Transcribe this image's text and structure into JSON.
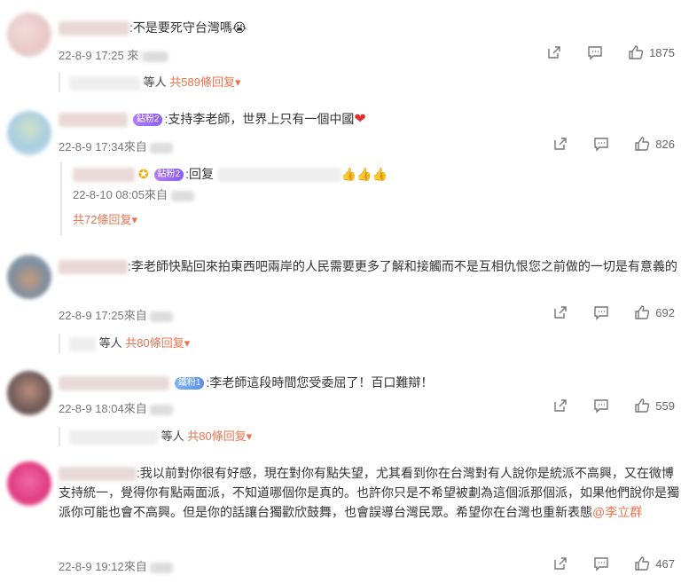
{
  "comments": [
    {
      "text": ":不是要死守台灣嗎😭",
      "time": "22-8-9 17:25",
      "source_prefix": "來",
      "likes": "1875",
      "summary_who": "等人",
      "summary_total": "共589條回复"
    },
    {
      "badge": "鉆粉2",
      "text": ":支持李老師，世界上只有一個中國",
      "time": "22-8-9 17:34",
      "source_prefix": "來自",
      "likes": "826",
      "reply": {
        "badge": "鉆粉2",
        "text": ":回复",
        "emoji": "👍👍👍",
        "time": "22-8-10 08:05",
        "source_prefix": "來自"
      },
      "summary_total": "共72條回复"
    },
    {
      "text": ":李老師快點回來拍東西吧兩岸的人民需要更多了解和接觸而不是互相仇恨您之前做的一切是有意義的",
      "time": "22-8-9 17:25",
      "source_prefix": "來自",
      "likes": "692",
      "summary_who": "等人",
      "summary_total": "共80條回复"
    },
    {
      "badge": "鐵粉1",
      "text": ":李老師這段時間您受委屈了！百口難辯！",
      "time": "22-8-9 18:04",
      "source_prefix": "來自",
      "likes": "559",
      "summary_who": "等人",
      "summary_total": "共80條回复"
    },
    {
      "text": ":我以前對你很有好感，現在對你有點失望，尤其看到你在台灣對有人說你是統派不高興，又在微博支持統一，覺得你有點兩面派，不知道哪個你是真的。也許你只是不希望被劃為這個派那個派，如果他們說你是獨派你可能也會不高興。但是你的話讓台獨歡欣鼓舞，也會誤導台灣民眾。希望你在台灣也重新表態",
      "mention": "@李立群",
      "time": "22-8-9 19:12",
      "source_prefix": "來自",
      "likes": "467"
    }
  ],
  "colors": {
    "accent": "#eb7350",
    "muted": "#777777"
  },
  "icons": {
    "share": "share-icon",
    "comment": "comment-icon",
    "like": "like-icon",
    "chevron": "chevron-down-icon"
  }
}
